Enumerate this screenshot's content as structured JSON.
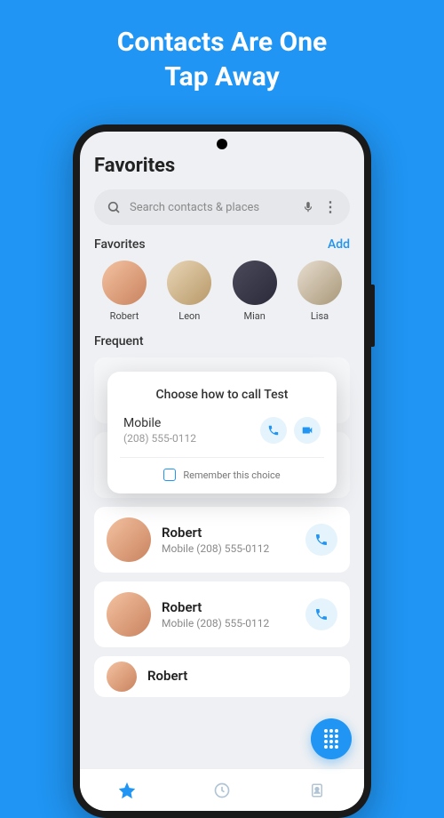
{
  "promo": {
    "line1": "Contacts Are One",
    "line2": "Tap Away"
  },
  "page_title": "Favorites",
  "search": {
    "placeholder": "Search contacts & places"
  },
  "favorites_section": {
    "label": "Favorites",
    "add_label": "Add"
  },
  "favorites": [
    {
      "name": "Robert"
    },
    {
      "name": "Leon"
    },
    {
      "name": "Mian"
    },
    {
      "name": "Lisa"
    }
  ],
  "frequent_section": {
    "label": "Frequent"
  },
  "contacts": [
    {
      "name": "Robert",
      "detail": "Mobile (208) 555-0112"
    },
    {
      "name": "Robert",
      "detail": "Mobile (208) 555-0112"
    },
    {
      "name": "Robert",
      "detail": ""
    }
  ],
  "dialog": {
    "title": "Choose how to call Test",
    "option_label": "Mobile",
    "option_number": "(208) 555-0112",
    "remember_label": "Remember this choice"
  },
  "colors": {
    "accent": "#2095f3",
    "background": "#eef0f3"
  }
}
